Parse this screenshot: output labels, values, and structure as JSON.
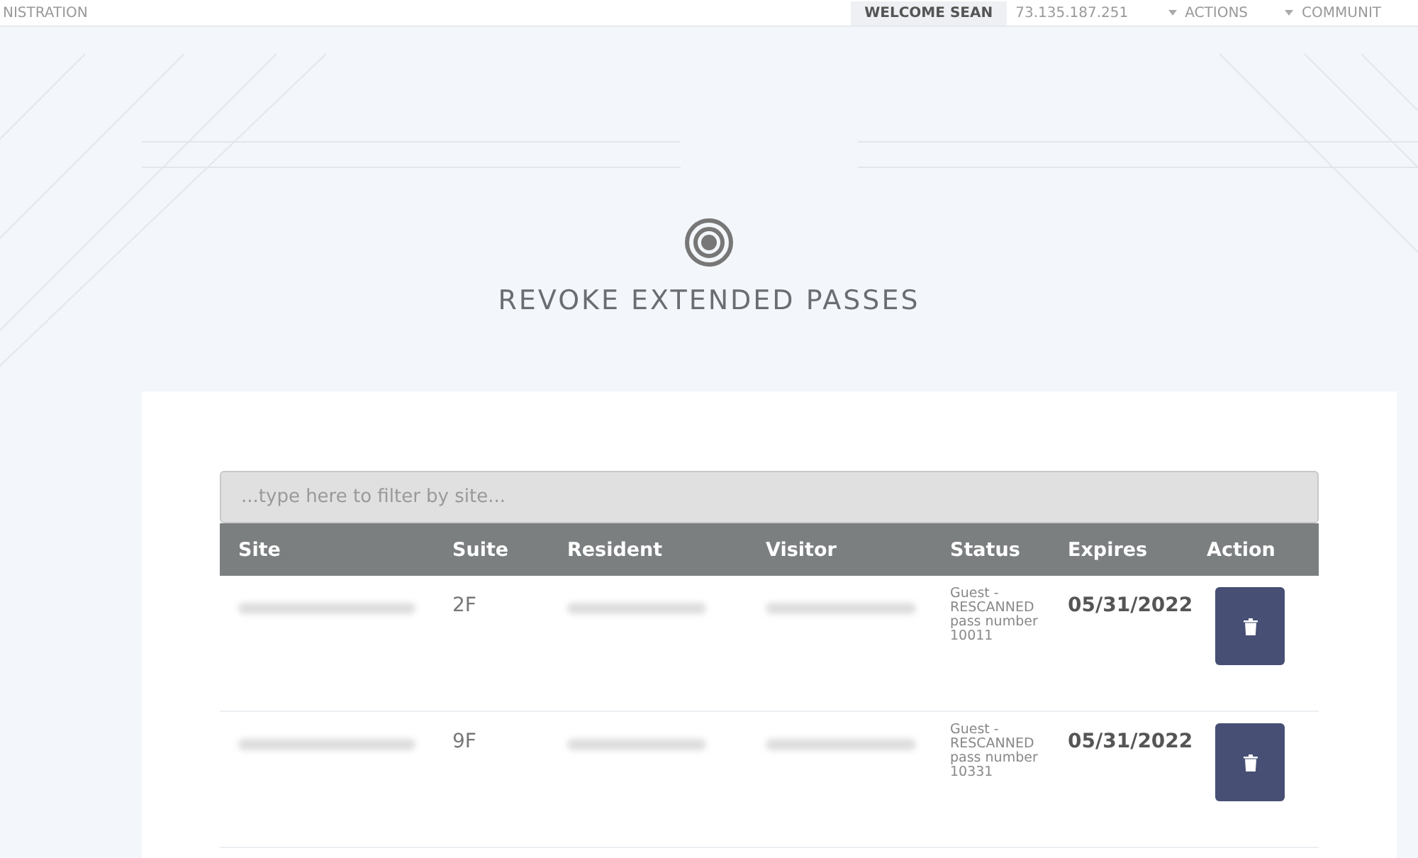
{
  "top_bar": {
    "left_text": "NISTRATION",
    "welcome": "WELCOME SEAN",
    "ip": "73.135.187.251",
    "menus": [
      "ACTIONS",
      "COMMUNIT"
    ]
  },
  "page_title": "REVOKE EXTENDED PASSES",
  "filter": {
    "placeholder": "...type here to filter by site..."
  },
  "table": {
    "columns": [
      "Site",
      "Suite",
      "Resident",
      "Visitor",
      "Status",
      "Expires",
      "Action"
    ],
    "rows": [
      {
        "site_redacted": true,
        "suite": "2F",
        "resident_redacted": true,
        "visitor_redacted": true,
        "status": "Guest - RESCANNED pass number 10011",
        "expires": "05/31/2022"
      },
      {
        "site_redacted": true,
        "suite": "9F",
        "resident_redacted": true,
        "visitor_redacted": true,
        "status": "Guest - RESCANNED pass number 10331",
        "expires": "05/31/2022"
      }
    ]
  }
}
